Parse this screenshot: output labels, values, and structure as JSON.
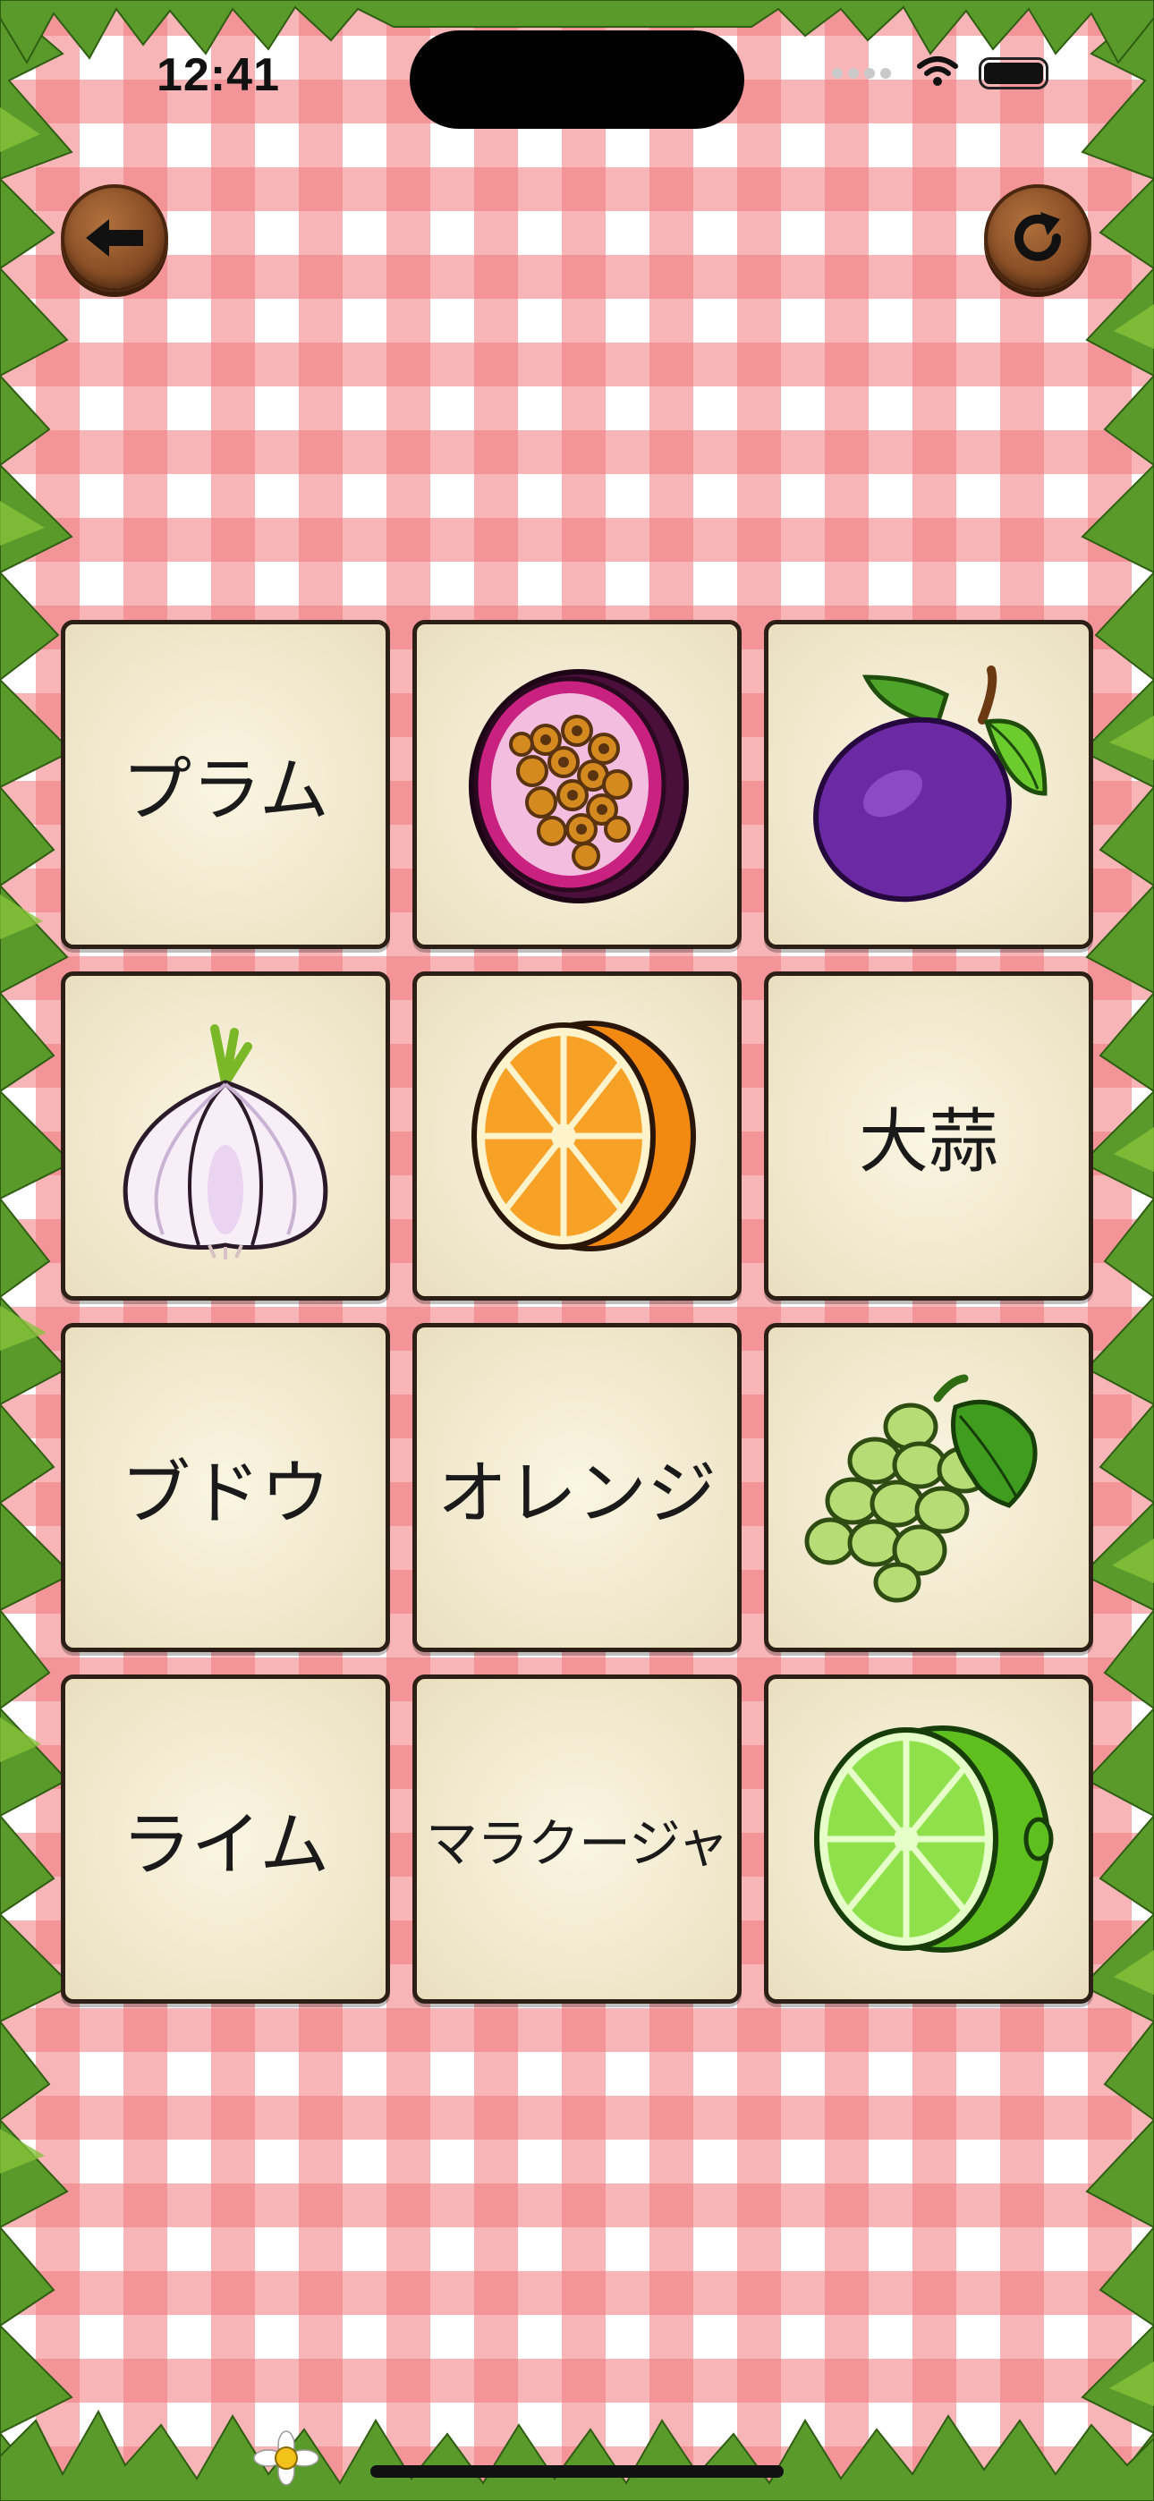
{
  "status_bar": {
    "time": "12:41",
    "icons": [
      "cellular-signal-icon",
      "wifi-icon",
      "battery-icon"
    ]
  },
  "toolbar": {
    "back_icon": "arrow-left-icon",
    "refresh_icon": "refresh-icon"
  },
  "colors": {
    "tablecloth_red": "#f0787d",
    "card_background": "#f1e8cd",
    "card_border": "#2c2016",
    "wood_button": "#8a4f26"
  },
  "cards": [
    {
      "type": "word",
      "text": "プラム"
    },
    {
      "type": "image",
      "icon": "passion-fruit-icon"
    },
    {
      "type": "image",
      "icon": "plum-icon"
    },
    {
      "type": "image",
      "icon": "garlic-icon"
    },
    {
      "type": "image",
      "icon": "orange-icon"
    },
    {
      "type": "word",
      "text": "大蒜"
    },
    {
      "type": "word",
      "text": "ブドウ"
    },
    {
      "type": "word",
      "text": "オレンジ"
    },
    {
      "type": "image",
      "icon": "grapes-icon"
    },
    {
      "type": "word",
      "text": "ライム"
    },
    {
      "type": "word",
      "text": "マラクージャ"
    },
    {
      "type": "image",
      "icon": "lime-icon"
    }
  ]
}
